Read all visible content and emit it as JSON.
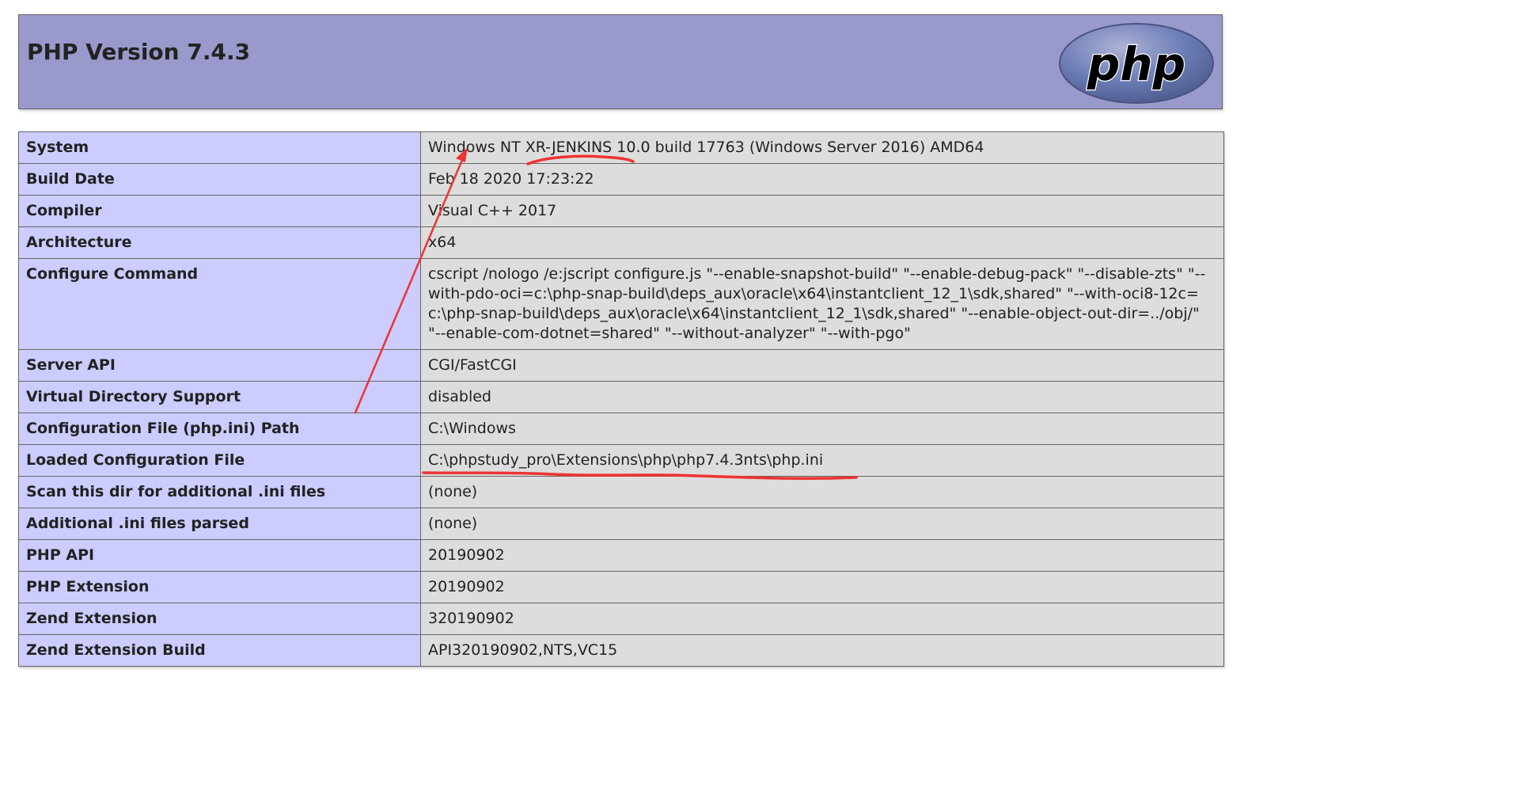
{
  "header": {
    "title": "PHP Version 7.4.3",
    "logo_text": "php"
  },
  "rows": [
    {
      "label": "System",
      "value": "Windows NT XR-JENKINS 10.0 build 17763 (Windows Server 2016) AMD64"
    },
    {
      "label": "Build Date",
      "value": "Feb 18 2020 17:23:22"
    },
    {
      "label": "Compiler",
      "value": "Visual C++ 2017"
    },
    {
      "label": "Architecture",
      "value": "x64"
    },
    {
      "label": "Configure Command",
      "value": "cscript /nologo /e:jscript configure.js \"--enable-snapshot-build\" \"--enable-debug-pack\" \"--disable-zts\" \"--with-pdo-oci=c:\\php-snap-build\\deps_aux\\oracle\\x64\\instantclient_12_1\\sdk,shared\" \"--with-oci8-12c=c:\\php-snap-build\\deps_aux\\oracle\\x64\\instantclient_12_1\\sdk,shared\" \"--enable-object-out-dir=../obj/\" \"--enable-com-dotnet=shared\" \"--without-analyzer\" \"--with-pgo\""
    },
    {
      "label": "Server API",
      "value": "CGI/FastCGI"
    },
    {
      "label": "Virtual Directory Support",
      "value": "disabled"
    },
    {
      "label": "Configuration File (php.ini) Path",
      "value": "C:\\Windows"
    },
    {
      "label": "Loaded Configuration File",
      "value": "C:\\phpstudy_pro\\Extensions\\php\\php7.4.3nts\\php.ini"
    },
    {
      "label": "Scan this dir for additional .ini files",
      "value": "(none)"
    },
    {
      "label": "Additional .ini files parsed",
      "value": "(none)"
    },
    {
      "label": "PHP API",
      "value": "20190902"
    },
    {
      "label": "PHP Extension",
      "value": "20190902"
    },
    {
      "label": "Zend Extension",
      "value": "320190902"
    },
    {
      "label": "Zend Extension Build",
      "value": "API320190902,NTS,VC15"
    }
  ],
  "colors": {
    "header_bg": "#9999cc",
    "label_bg": "#ccccff",
    "value_bg": "#dddddd",
    "annotation": "#ee3333",
    "logo_bg": "#6c7eb7"
  }
}
